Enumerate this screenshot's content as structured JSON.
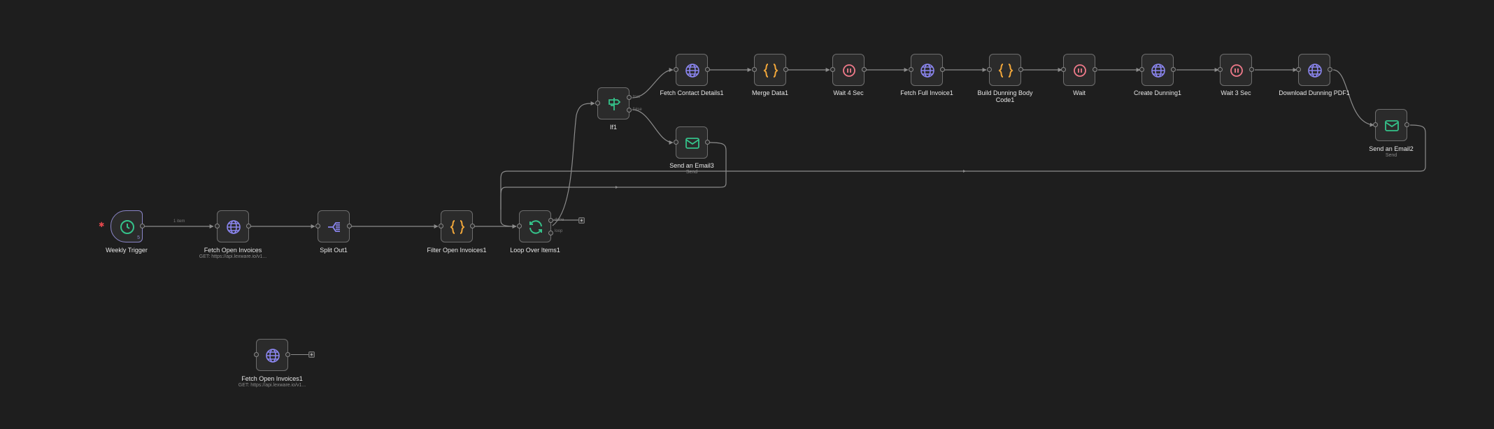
{
  "nodes": {
    "weekly_trigger": {
      "label": "Weekly Trigger",
      "badge": "5",
      "icon": "clock-icon",
      "color": "#35c28a"
    },
    "fetch_open_invoices": {
      "label": "Fetch Open Invoices",
      "sublabel": "GET: https://api.lexware.io/v1...",
      "icon": "globe-icon",
      "color": "#8b86f0"
    },
    "split_out1": {
      "label": "Split Out1",
      "icon": "split-icon",
      "color": "#8b86f0"
    },
    "filter_open_invoices1": {
      "label": "Filter Open Invoices1",
      "icon": "code-braces-icon",
      "color": "#f0a63a"
    },
    "loop_over_items1": {
      "label": "Loop Over Items1",
      "icon": "loop-icon",
      "color": "#35c28a"
    },
    "if1": {
      "label": "If1",
      "icon": "signpost-icon",
      "color": "#35c28a"
    },
    "fetch_contact_details1": {
      "label": "Fetch Contact Details1",
      "icon": "globe-icon",
      "color": "#8b86f0"
    },
    "merge_data1": {
      "label": "Merge Data1",
      "icon": "code-braces-icon",
      "color": "#f0a63a"
    },
    "wait_4_sec": {
      "label": "Wait 4 Sec",
      "icon": "pause-icon",
      "color": "#f07a8a"
    },
    "fetch_full_invoice1": {
      "label": "Fetch Full Invoice1",
      "icon": "globe-icon",
      "color": "#8b86f0"
    },
    "build_dunning_body_code1": {
      "label": "Build Dunning Body",
      "label2": "Code1",
      "icon": "code-braces-icon",
      "color": "#f0a63a"
    },
    "wait": {
      "label": "Wait",
      "icon": "pause-icon",
      "color": "#f07a8a"
    },
    "create_dunning1": {
      "label": "Create Dunning1",
      "icon": "globe-icon",
      "color": "#8b86f0"
    },
    "wait_3_sec": {
      "label": "Wait 3 Sec",
      "icon": "pause-icon",
      "color": "#f07a8a"
    },
    "download_dunning_pdf1": {
      "label": "Download Dunning PDF1",
      "icon": "globe-icon",
      "color": "#8b86f0"
    },
    "send_an_email3": {
      "label": "Send an Email3",
      "sublabel": "Send",
      "icon": "mail-icon",
      "color": "#35c28a"
    },
    "send_an_email2": {
      "label": "Send an Email2",
      "sublabel": "Send",
      "icon": "mail-icon",
      "color": "#35c28a"
    },
    "fetch_open_invoices1": {
      "label": "Fetch Open Invoices1",
      "sublabel": "GET: https://api.lexware.io/v1...",
      "icon": "globe-icon",
      "color": "#8b86f0"
    }
  },
  "edge_labels": {
    "trigger_items": "1 item",
    "if_true": "true",
    "if_false": "false",
    "loop_done": "done",
    "loop_loop": "loop"
  },
  "colors": {
    "background": "#1e1e1e",
    "node_fill": "#2b2b2b",
    "node_border": "#6e6e6e",
    "edge": "#8c8c8c",
    "trigger_accent": "#8b86c9",
    "trigger_zap": "#e5484d"
  }
}
